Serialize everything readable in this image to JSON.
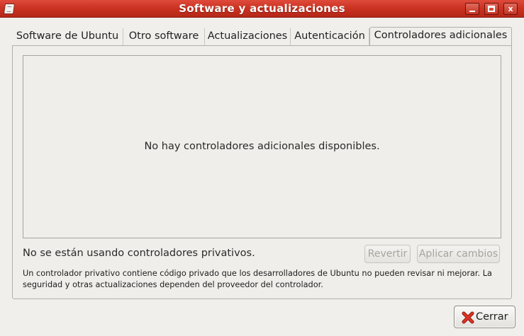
{
  "window": {
    "title": "Software y actualizaciones",
    "controls": {
      "minimize_icon": "minimize-icon",
      "maximize_icon": "maximize-icon",
      "close_icon": "close-icon",
      "close_label": "x"
    }
  },
  "tabs": [
    {
      "label": "Software de Ubuntu",
      "active": false
    },
    {
      "label": "Otro software",
      "active": false
    },
    {
      "label": "Actualizaciones",
      "active": false
    },
    {
      "label": "Autenticación",
      "active": false
    },
    {
      "label": "Controladores adicionales",
      "active": true
    }
  ],
  "drivers": {
    "empty_message": "No hay controladores adicionales disponibles.",
    "status": "No se están usando controladores privativos.",
    "revert_label": "Revertir",
    "apply_label": "Aplicar cambios",
    "info": "Un controlador privativo contiene código privado que los desarrolladores de Ubuntu no pueden revisar ni mejorar. La seguridad y otras actualizaciones dependen del proveedor del controlador."
  },
  "footer": {
    "close_label": "Cerrar",
    "close_icon": "cancel-x-icon"
  },
  "colors": {
    "titlebar": "#c8301f",
    "window_bg": "#f0efec",
    "close_icon": "#d42a1a"
  }
}
